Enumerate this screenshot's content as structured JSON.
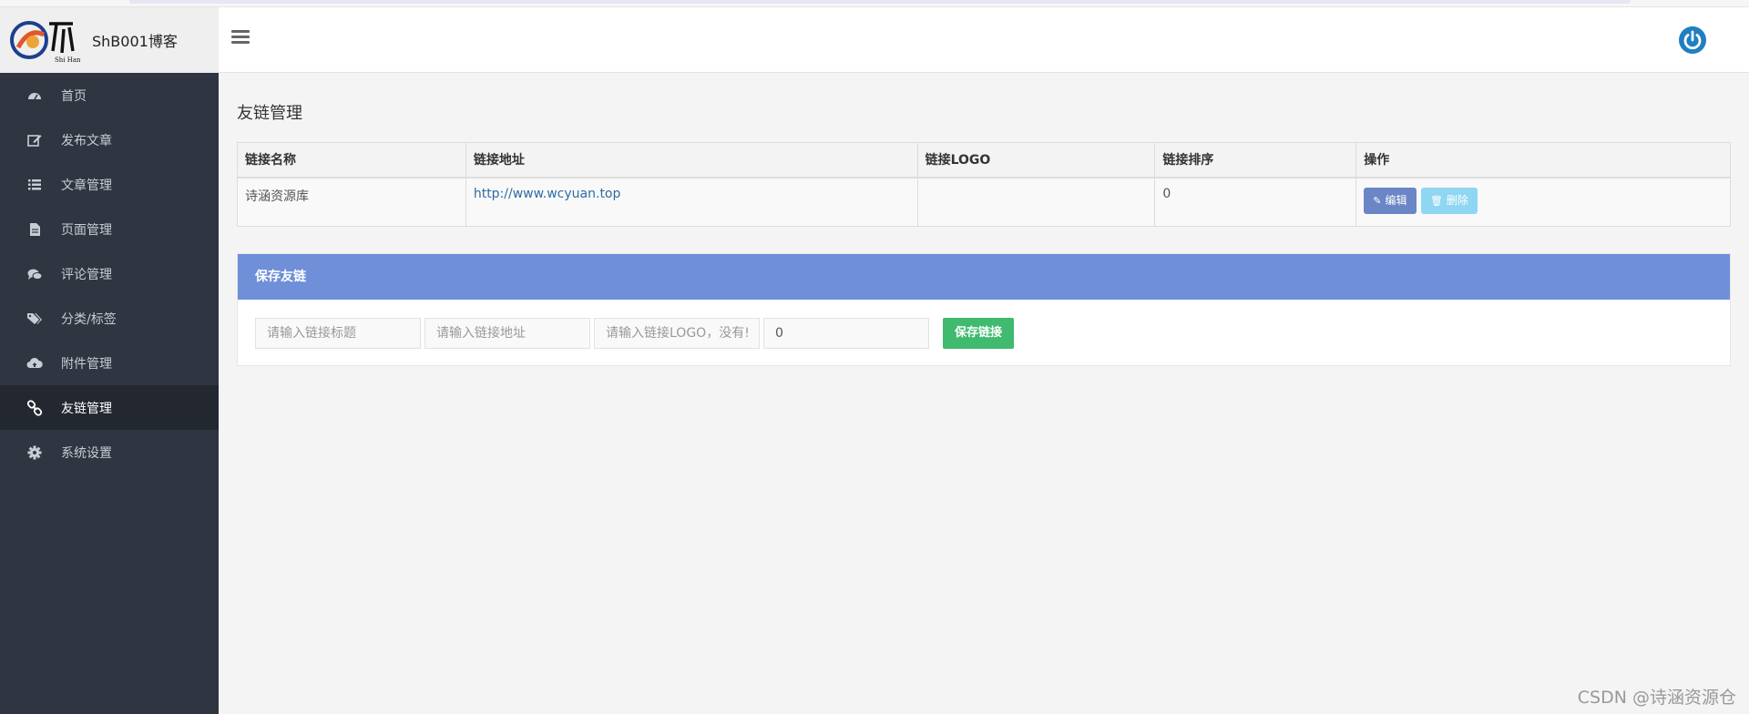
{
  "brand": {
    "title": "ShB001博客",
    "logo_text": "Shi Han"
  },
  "sidebar": {
    "items": [
      {
        "label": "首页",
        "icon": "dashboard-icon",
        "active": false
      },
      {
        "label": "发布文章",
        "icon": "edit-icon",
        "active": false
      },
      {
        "label": "文章管理",
        "icon": "list-icon",
        "active": false
      },
      {
        "label": "页面管理",
        "icon": "file-icon",
        "active": false
      },
      {
        "label": "评论管理",
        "icon": "comments-icon",
        "active": false
      },
      {
        "label": "分类/标签",
        "icon": "tags-icon",
        "active": false
      },
      {
        "label": "附件管理",
        "icon": "cloud-upload-icon",
        "active": false
      },
      {
        "label": "友链管理",
        "icon": "link-icon",
        "active": true
      },
      {
        "label": "系统设置",
        "icon": "gear-icon",
        "active": false
      }
    ]
  },
  "main": {
    "title": "友链管理",
    "table": {
      "headers": [
        "链接名称",
        "链接地址",
        "链接LOGO",
        "链接排序",
        "操作"
      ],
      "rows": [
        {
          "name": "诗涵资源库",
          "url": "http://www.wcyuan.top",
          "logo": "",
          "sort": "0",
          "edit_label": "编辑",
          "delete_label": "删除"
        }
      ]
    },
    "form": {
      "header": "保存友链",
      "title_placeholder": "请输入链接标题",
      "url_placeholder": "请输入链接地址",
      "logo_placeholder": "请输入链接LOGO，没有!",
      "sort_value": "0",
      "save_label": "保存链接"
    }
  },
  "watermark": "CSDN @诗涵资源仓",
  "colors": {
    "sidebar_bg": "#2f3541",
    "panel_header": "#6f8fd8",
    "save_button": "#3fba6e",
    "edit_button": "#6b86c7",
    "delete_button": "#8fd6f2",
    "power_icon": "#1f7fc0"
  }
}
